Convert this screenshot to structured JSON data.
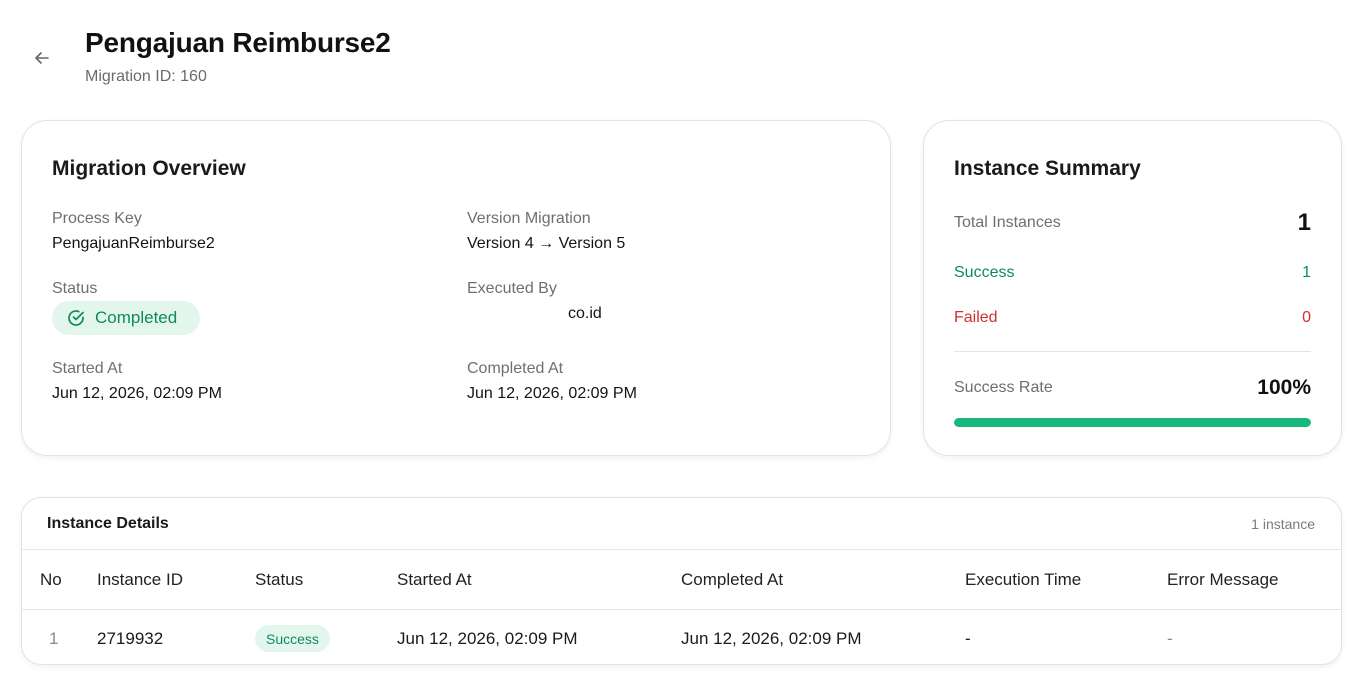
{
  "header": {
    "title": "Pengajuan Reimburse2",
    "subtitle": "Migration ID: 160"
  },
  "overview": {
    "title": "Migration Overview",
    "process_key_label": "Process Key",
    "process_key_value": "PengajuanReimburse2",
    "version_label": "Version Migration",
    "version_value": "Version 4 → Version 5",
    "status_label": "Status",
    "status_value": "Completed",
    "executed_by_label": "Executed By",
    "executed_by_value": "co.id",
    "started_label": "Started At",
    "started_value": "Jun 12, 2026, 02:09 PM",
    "completed_label": "Completed At",
    "completed_value": "Jun 12, 2026, 02:09 PM"
  },
  "summary": {
    "title": "Instance Summary",
    "total_label": "Total Instances",
    "total_value": "1",
    "success_label": "Success",
    "success_value": "1",
    "failed_label": "Failed",
    "failed_value": "0",
    "rate_label": "Success Rate",
    "rate_value": "100%",
    "rate_fraction": 1.0
  },
  "details": {
    "title": "Instance Details",
    "count": "1 instance",
    "columns": [
      "No",
      "Instance ID",
      "Status",
      "Started At",
      "Completed At",
      "Execution Time",
      "Error Message"
    ],
    "rows": [
      {
        "no": "1",
        "instance_id": "2719932",
        "status": "Success",
        "started": "Jun 12, 2026, 02:09 PM",
        "completed": "Jun 12, 2026, 02:09 PM",
        "execution_time": "-",
        "error": "-"
      }
    ]
  },
  "colors": {
    "success": "#0f8a5f",
    "success_bg": "#e3f6ee",
    "failed": "#d32f2f",
    "progress": "#16b97b"
  }
}
